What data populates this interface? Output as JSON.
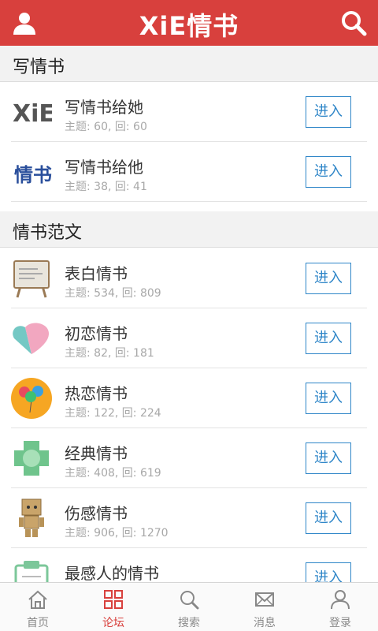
{
  "header": {
    "title": "XiE情书",
    "user_icon": "user-icon",
    "search_icon": "search-icon",
    "bg_color": "#d8403d"
  },
  "sections": [
    {
      "title": "写情书",
      "items": [
        {
          "icon": "xie-logo-icon",
          "name": "写情书给她",
          "stats": "主题: 60, 回: 60",
          "button": "进入"
        },
        {
          "icon": "qingshu-text-icon",
          "name": "写情书给他",
          "stats": "主题: 38, 回: 41",
          "button": "进入"
        }
      ]
    },
    {
      "title": "情书范文",
      "items": [
        {
          "icon": "board-icon",
          "name": "表白情书",
          "stats": "主题: 534, 回: 809",
          "button": "进入"
        },
        {
          "icon": "heart-icon",
          "name": "初恋情书",
          "stats": "主题: 82, 回: 181",
          "button": "进入"
        },
        {
          "icon": "balloons-icon",
          "name": "热恋情书",
          "stats": "主题: 122, 回: 224",
          "button": "进入"
        },
        {
          "icon": "green-square-icon",
          "name": "经典情书",
          "stats": "主题: 408, 回: 619",
          "button": "进入"
        },
        {
          "icon": "danbo-figure-icon",
          "name": "伤感情书",
          "stats": "主题: 906, 回: 1270",
          "button": "进入"
        },
        {
          "icon": "clipboard-icon",
          "name": "最感人的情书",
          "stats": "",
          "button": "进入"
        }
      ]
    }
  ],
  "tabbar": {
    "active_color": "#d8403d",
    "tabs": [
      {
        "label": "首页",
        "icon": "home-icon",
        "active": false
      },
      {
        "label": "论坛",
        "icon": "forum-grid-icon",
        "active": true
      },
      {
        "label": "搜索",
        "icon": "search-icon",
        "active": false
      },
      {
        "label": "消息",
        "icon": "mail-icon",
        "active": false
      },
      {
        "label": "登录",
        "icon": "user-icon",
        "active": false
      }
    ]
  }
}
